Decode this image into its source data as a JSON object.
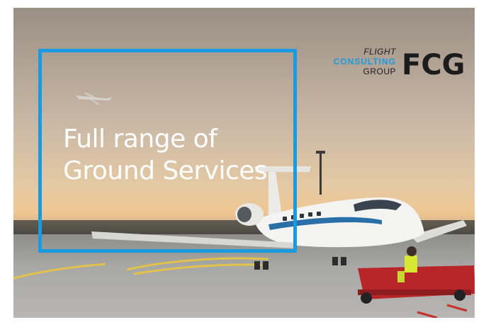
{
  "headline": {
    "line1": "Full range of",
    "line2": "Ground Services"
  },
  "logo": {
    "flight": "FLIGHT",
    "consulting": "CONSULTING",
    "group": "GROUP",
    "mark": "FCG",
    "colors": {
      "blue": "#1a9be0",
      "dark": "#1c1c1c"
    }
  },
  "frame_color": "#1a9be0"
}
